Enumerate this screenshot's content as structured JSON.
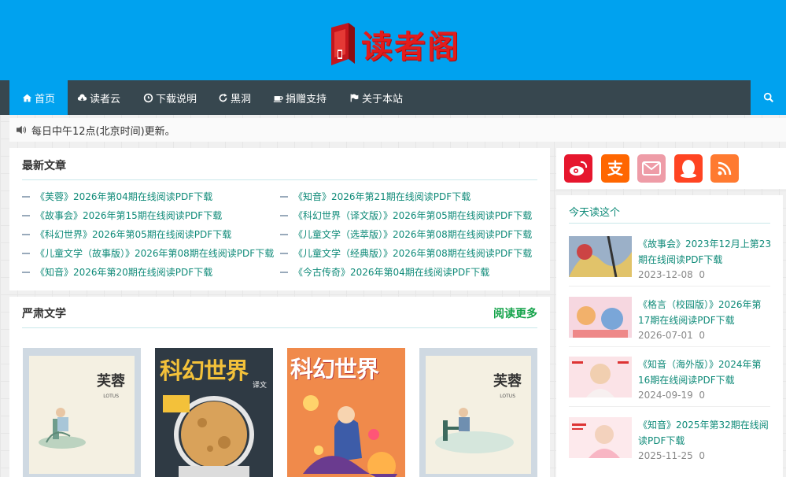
{
  "site": {
    "logo_text": "读者阁"
  },
  "nav": {
    "items": [
      {
        "label": "首页",
        "icon": "home-icon"
      },
      {
        "label": "读者云",
        "icon": "cloud-download-icon"
      },
      {
        "label": "下载说明",
        "icon": "clock-icon"
      },
      {
        "label": "黑洞",
        "icon": "refresh-icon"
      },
      {
        "label": "捐赠支持",
        "icon": "coffee-icon"
      },
      {
        "label": "关于本站",
        "icon": "flag-icon"
      }
    ],
    "search_icon": "search-icon"
  },
  "notice": {
    "icon": "speaker-icon",
    "text": "每日中午12点(北京时间)更新。"
  },
  "latest": {
    "title": "最新文章",
    "left": [
      "《芙蓉》2026年第04期在线阅读PDF下载",
      "《故事会》2026年第15期在线阅读PDF下载",
      "《科幻世界》2026年第05期在线阅读PDF下载",
      "《儿童文学（故事版）》2026年第08期在线阅读PDF下载",
      "《知音》2026年第20期在线阅读PDF下载"
    ],
    "right": [
      "《知音》2026年第21期在线阅读PDF下载",
      "《科幻世界（译文版）》2026年第05期在线阅读PDF下载",
      "《儿童文学（选萃版）》2026年第08期在线阅读PDF下载",
      "《儿童文学（经典版）》2026年第08期在线阅读PDF下载",
      "《今古传奇》2026年第04期在线阅读PDF下载"
    ]
  },
  "serious": {
    "title": "严肃文学",
    "more_label": "阅读更多",
    "covers": [
      {
        "name": "furong-cover",
        "title": "芙蓉",
        "sub": "LOTUS"
      },
      {
        "name": "kehuan-yiwen-cover",
        "title": "科幻世界",
        "sub": "译文"
      },
      {
        "name": "kehuan-cover",
        "title": "科幻世界",
        "sub": ""
      },
      {
        "name": "furong-cover-2",
        "title": "芙蓉",
        "sub": "LOTUS"
      }
    ]
  },
  "social": [
    {
      "icon": "weibo-icon",
      "color": "#e6162d"
    },
    {
      "icon": "alipay-icon",
      "color": "#ff6600"
    },
    {
      "icon": "mail-icon",
      "color": "#ee9ca7"
    },
    {
      "icon": "qq-icon",
      "color": "#ff4422"
    },
    {
      "icon": "rss-icon",
      "color": "#ff7a30"
    }
  ],
  "today": {
    "title": "今天读这个",
    "items": [
      {
        "title": "《故事会》2023年12月上第23期在线阅读PDF下载",
        "date": "2023-12-08",
        "comments": "0"
      },
      {
        "title": "《格言（校园版）》2026年第17期在线阅读PDF下载",
        "date": "2026-07-01",
        "comments": "0"
      },
      {
        "title": "《知音（海外版）》2024年第16期在线阅读PDF下载",
        "date": "2024-09-19",
        "comments": "0"
      },
      {
        "title": "《知音》2025年第32期在线阅读PDF下载",
        "date": "2025-11-25",
        "comments": "0"
      }
    ]
  },
  "colors": {
    "header": "#00a2ef",
    "nav": "#37474f",
    "link": "#0e8a78",
    "more": "#14a34a"
  }
}
